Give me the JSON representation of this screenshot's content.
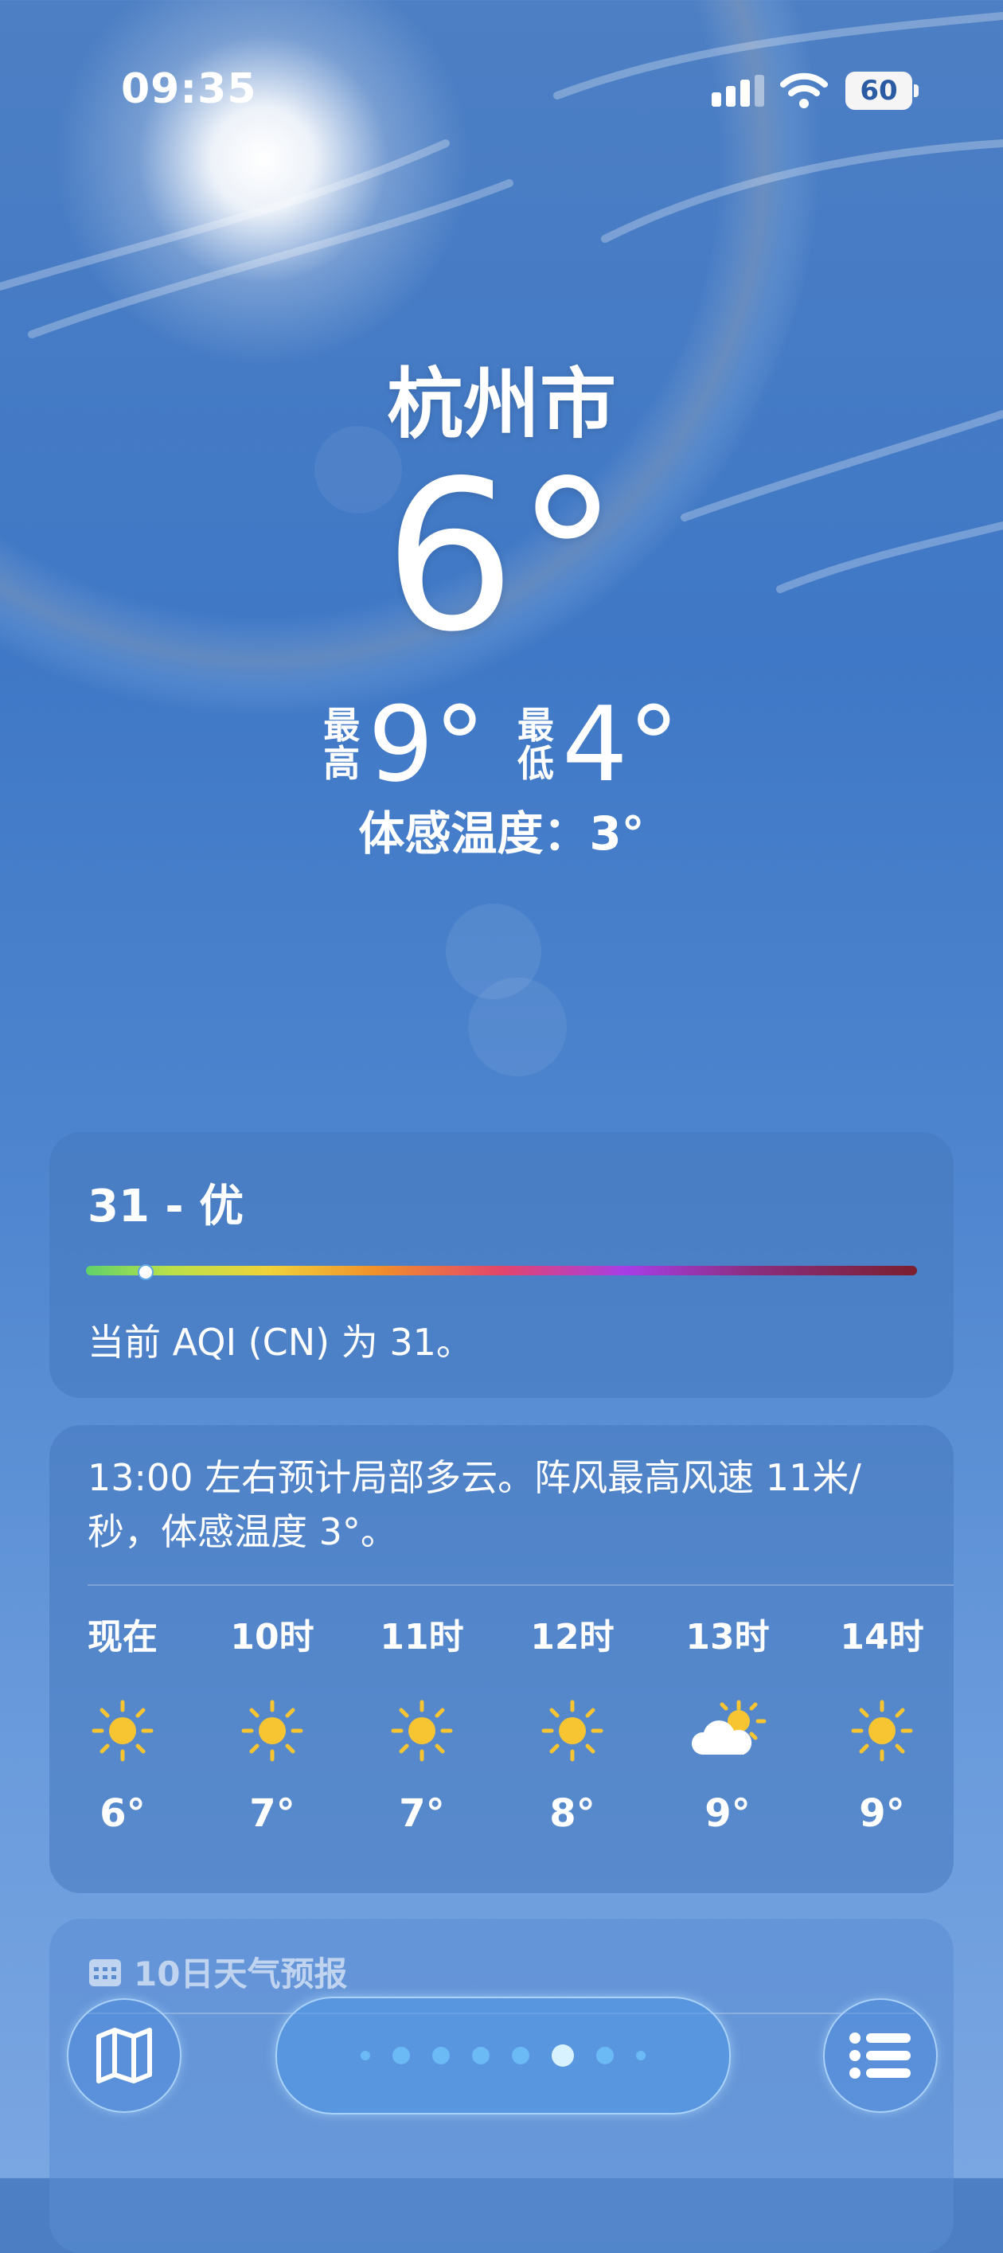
{
  "status_bar": {
    "time": "09:35",
    "battery": "60"
  },
  "location": {
    "city": "杭州市",
    "temperature": "6°",
    "high_label_1": "最",
    "high_label_2": "高",
    "high": "9°",
    "low_label_1": "最",
    "low_label_2": "低",
    "low": "4°",
    "feels_like": "体感温度：3°"
  },
  "aqi": {
    "value_text": "31 - 优",
    "description": "当前 AQI (CN) 为 31。",
    "level": 0.07
  },
  "hourly": {
    "summary": "13:00 左右预计局部多云。阵风最高风速 11米/秒，体感温度 3°。",
    "items": [
      {
        "label": "现在",
        "icon": "sun-icon",
        "temp": "6°"
      },
      {
        "label": "10时",
        "icon": "sun-icon",
        "temp": "7°"
      },
      {
        "label": "11时",
        "icon": "sun-icon",
        "temp": "7°"
      },
      {
        "label": "12时",
        "icon": "sun-icon",
        "temp": "8°"
      },
      {
        "label": "13时",
        "icon": "partly-cloudy-icon",
        "temp": "9°"
      },
      {
        "label": "14时",
        "icon": "sun-icon",
        "temp": "9°"
      }
    ]
  },
  "forecast": {
    "title": "10日天气预报"
  },
  "nav": {
    "page_count": 8,
    "active_index": 5
  },
  "colors": {
    "sun": "#f7c531",
    "accent": "#d8f3ff"
  }
}
